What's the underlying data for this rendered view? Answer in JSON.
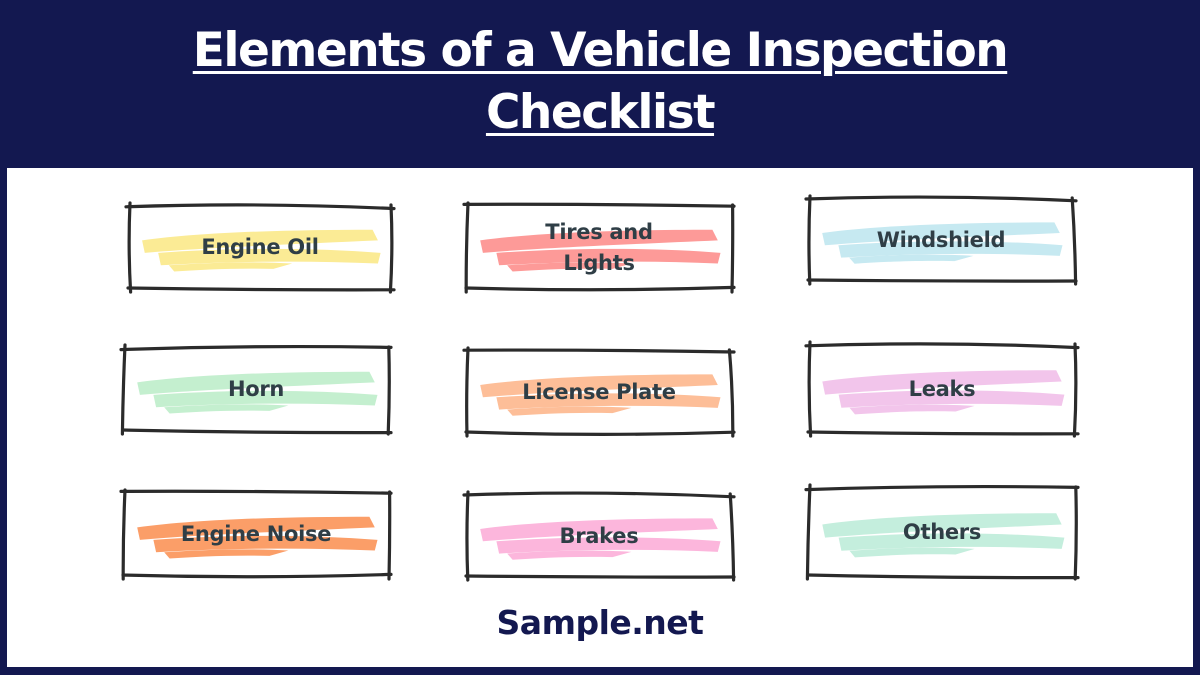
{
  "header": {
    "title_line1": "Elements of a Vehicle Inspection",
    "title_line2": "Checklist"
  },
  "colors": {
    "background": "#131850",
    "panel": "#ffffff",
    "text": "#2f3e46",
    "border": "#2b2b2b"
  },
  "cards": [
    {
      "label": "Engine Oil",
      "highlight": "#fbeb95"
    },
    {
      "label": "Tires and Lights",
      "highlight": "#fd9a98"
    },
    {
      "label": "Windshield",
      "highlight": "#c6e9f1"
    },
    {
      "label": "Horn",
      "highlight": "#c4efcf"
    },
    {
      "label": "License Plate",
      "highlight": "#fdbe98"
    },
    {
      "label": "Leaks",
      "highlight": "#f2c5eb"
    },
    {
      "label": "Engine Noise",
      "highlight": "#fb9e68"
    },
    {
      "label": "Brakes",
      "highlight": "#fcb6dc"
    },
    {
      "label": "Others",
      "highlight": "#c4eedd"
    }
  ],
  "footer": {
    "brand": "Sample.net"
  }
}
